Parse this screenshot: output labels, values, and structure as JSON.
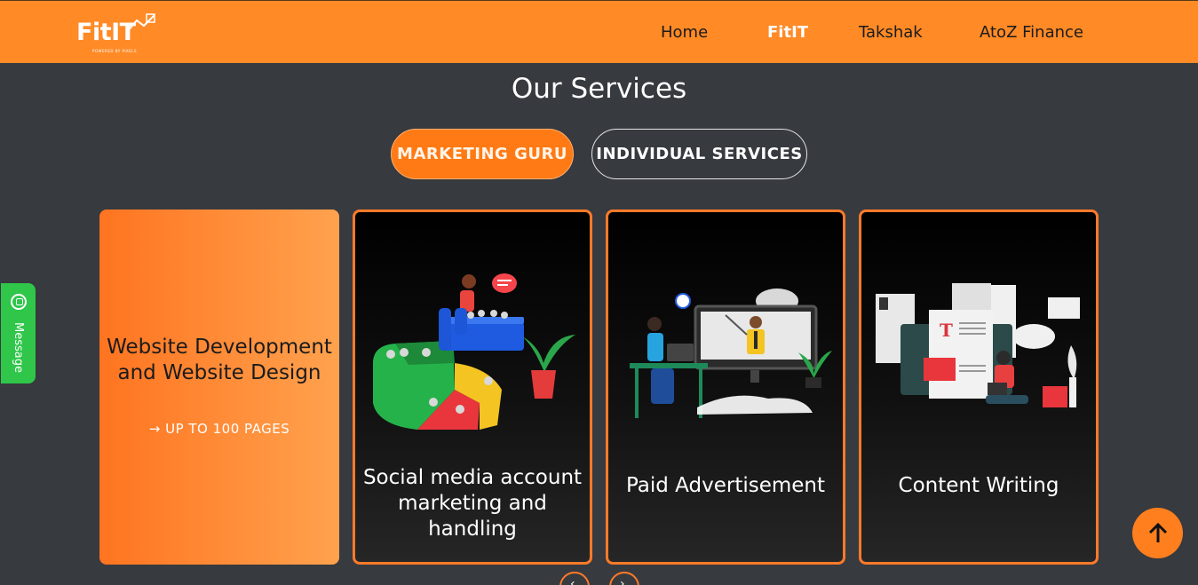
{
  "header": {
    "logo_text": "FitIT",
    "logo_sub": "POWERED BY PIXELS",
    "nav": [
      {
        "label": "Home",
        "active": false
      },
      {
        "label": "FitIT",
        "active": true
      },
      {
        "label": "Takshak",
        "active": false
      },
      {
        "label": "AtoZ Finance",
        "active": false
      }
    ]
  },
  "main": {
    "title": "Our Services",
    "tabs": [
      {
        "label": "MARKETING GURU",
        "active": true
      },
      {
        "label": "INDIVIDUAL SERVICES",
        "active": false
      }
    ],
    "cards": [
      {
        "heading": "Website Development and Website Design",
        "sub": "→ UP TO 100 PAGES"
      },
      {
        "caption": "Social media account marketing and handling",
        "illustration": "social-media-illustration"
      },
      {
        "caption": "Paid Advertisement",
        "illustration": "paid-ad-illustration"
      },
      {
        "caption": "Content Writing",
        "illustration": "content-writing-illustration"
      }
    ]
  },
  "side_message": {
    "label": "Message",
    "icon": "whatsapp-icon"
  },
  "controls": {
    "prev_icon": "chevron-left-icon",
    "next_icon": "chevron-right-icon",
    "scroll_top_icon": "arrow-up-icon"
  },
  "colors": {
    "brand": "#ff8a26",
    "background": "#373a3f",
    "whatsapp": "#2fc64a"
  }
}
